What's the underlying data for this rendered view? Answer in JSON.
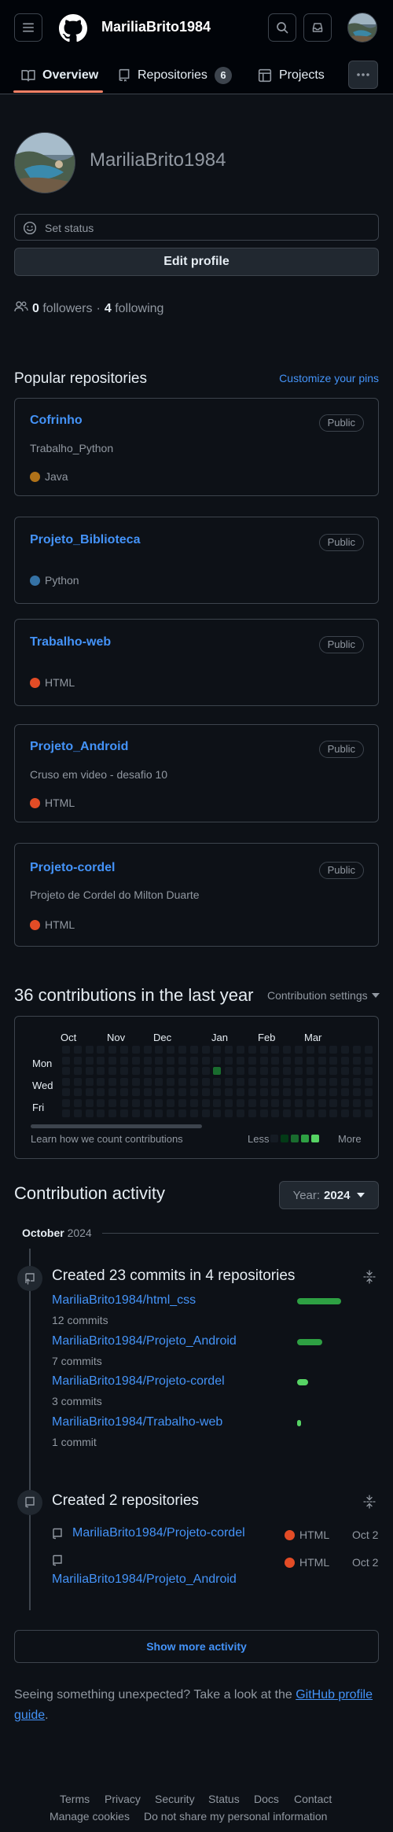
{
  "header": {
    "username": "MariliaBrito1984"
  },
  "tabs": [
    {
      "label": "Overview"
    },
    {
      "label": "Repositories",
      "count": "6"
    },
    {
      "label": "Projects"
    }
  ],
  "profile": {
    "name": "MariliaBrito1984",
    "set_status": "Set status",
    "edit_profile": "Edit profile",
    "followers_count": "0",
    "followers_label": "followers",
    "separator": "·",
    "following_count": "4",
    "following_label": "following"
  },
  "popular": {
    "title": "Popular repositories",
    "customize": "Customize your pins",
    "repos": [
      {
        "name": "Cofrinho",
        "visibility": "Public",
        "description": "Trabalho_Python",
        "language": "Java",
        "lang_color": "#b07219"
      },
      {
        "name": "Projeto_Biblioteca",
        "visibility": "Public",
        "description": "",
        "language": "Python",
        "lang_color": "#3572A5"
      },
      {
        "name": "Trabalho-web",
        "visibility": "Public",
        "description": "",
        "language": "HTML",
        "lang_color": "#e34c26"
      },
      {
        "name": "Projeto_Android",
        "visibility": "Public",
        "description": "Cruso em video - desafio 10",
        "language": "HTML",
        "lang_color": "#e34c26"
      },
      {
        "name": "Projeto-cordel",
        "visibility": "Public",
        "description": "Projeto de Cordel do Milton Duarte",
        "language": "HTML",
        "lang_color": "#e34c26"
      }
    ]
  },
  "contributions": {
    "title": "36 contributions in the last year",
    "settings": "Contribution settings",
    "months": [
      "Oct",
      "Nov",
      "Dec",
      "Jan",
      "Feb",
      "Mar"
    ],
    "days": [
      "Mon",
      "Wed",
      "Fri"
    ],
    "learn": "Learn how we count contributions",
    "less": "Less",
    "more": "More",
    "legend_colors": [
      "#151b23",
      "#033a16",
      "#196c2e",
      "#2ea043",
      "#56d364"
    ]
  },
  "activity": {
    "title": "Contribution activity",
    "year_label": "Year:",
    "year": "2024",
    "month": "October",
    "month_year": "2024",
    "commits_title": "Created 23 commits in 4 repositories",
    "commits": [
      {
        "repo": "MariliaBrito1984/html_css",
        "count": "12 commits",
        "fraction": 1.0
      },
      {
        "repo": "MariliaBrito1984/Projeto_Android",
        "count": "7 commits",
        "fraction": 0.58
      },
      {
        "repo": "MariliaBrito1984/Projeto-cordel",
        "count": "3 commits",
        "fraction": 0.25
      },
      {
        "repo": "MariliaBrito1984/Trabalho-web",
        "count": "1 commit",
        "fraction": 0.08
      }
    ],
    "created_title": "Created 2 repositories",
    "created": [
      {
        "repo": "MariliaBrito1984/Projeto-cordel",
        "language": "HTML",
        "date": "Oct 2"
      },
      {
        "repo": "MariliaBrito1984/Projeto_Android",
        "language": "HTML",
        "date": "Oct 2"
      }
    ],
    "show_more": "Show more activity",
    "unexpected_prefix": "Seeing something unexpected? Take a look at the ",
    "unexpected_link": "GitHub profile guide",
    "unexpected_suffix": "."
  },
  "footer": {
    "links_row1": [
      "Terms",
      "Privacy",
      "Security",
      "Status",
      "Docs",
      "Contact"
    ],
    "links_row2": [
      "Manage cookies",
      "Do not share my personal information"
    ]
  }
}
